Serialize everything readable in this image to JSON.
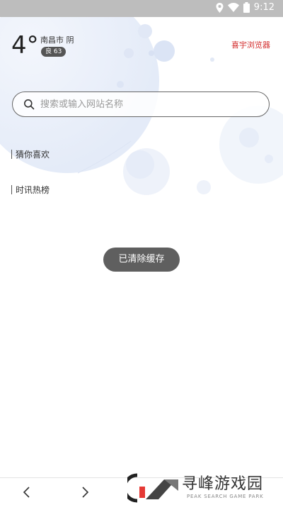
{
  "status_bar": {
    "time": "9:12",
    "icons": [
      "location-icon",
      "wifi-icon",
      "battery-icon"
    ]
  },
  "weather": {
    "temperature": "4°",
    "location": "南昌市 阴",
    "aqi": "良 63"
  },
  "brand": {
    "label": "喜宇浏览器",
    "color": "#d32f2f"
  },
  "search": {
    "placeholder": "搜索或输入网站名称",
    "value": ""
  },
  "sections": {
    "guess": "猜你喜欢",
    "hot": "时讯热榜"
  },
  "toast": {
    "text": "已清除缓存"
  },
  "bottom_nav": {
    "back_icon": "chevron-left-icon",
    "forward_icon": "chevron-right-icon"
  },
  "watermark": {
    "title": "寻峰游戏园",
    "subtitle": "PEAK SEARCH GAME PARK"
  }
}
